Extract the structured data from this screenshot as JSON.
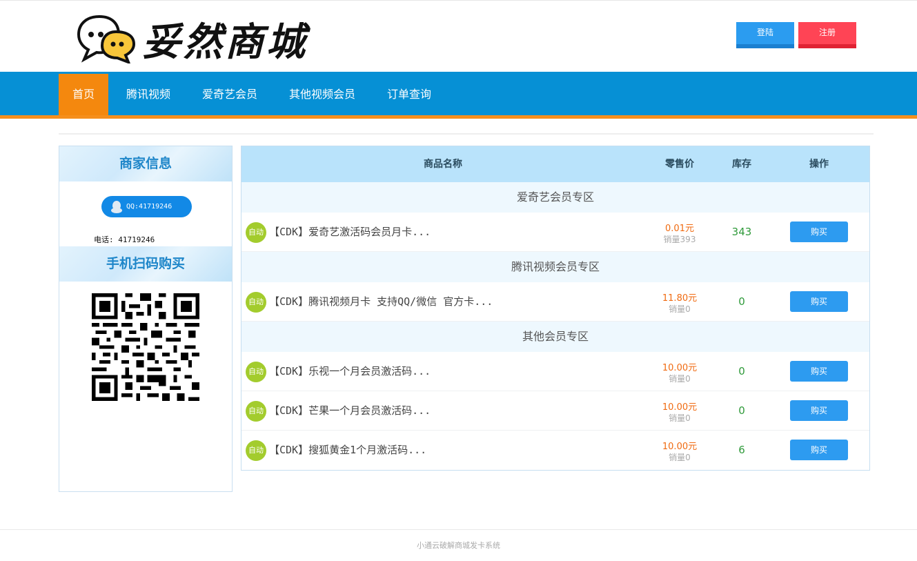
{
  "header": {
    "logo_text": "妥然商城",
    "login_label": "登陆",
    "register_label": "注册"
  },
  "nav": {
    "items": [
      {
        "label": "首页",
        "active": true
      },
      {
        "label": "腾讯视频"
      },
      {
        "label": "爱奇艺会员"
      },
      {
        "label": "其他视频会员"
      },
      {
        "label": "订单查询"
      }
    ]
  },
  "sidebar": {
    "merchant_title": "商家信息",
    "qq_label": "QQ:41719246",
    "phone_label": "电话: 41719246",
    "scan_title": "手机扫码购买"
  },
  "table": {
    "headers": {
      "name": "商品名称",
      "price": "零售价",
      "stock": "库存",
      "action": "操作"
    },
    "sections": [
      {
        "title": "爱奇艺会员专区",
        "rows": [
          {
            "badge": "自动",
            "name": "【CDK】爱奇艺激活码会员月卡...",
            "price": "0.01元",
            "sales": "销量393",
            "stock": "343",
            "buy": "购买"
          }
        ]
      },
      {
        "title": "腾讯视频会员专区",
        "rows": [
          {
            "badge": "自动",
            "name": "【CDK】腾讯视频月卡 支持QQ/微信 官方卡...",
            "price": "11.80元",
            "sales": "销量0",
            "stock": "0",
            "buy": "购买"
          }
        ]
      },
      {
        "title": "其他会员专区",
        "rows": [
          {
            "badge": "自动",
            "name": "【CDK】乐视一个月会员激活码...",
            "price": "10.00元",
            "sales": "销量0",
            "stock": "0",
            "buy": "购买"
          },
          {
            "badge": "自动",
            "name": "【CDK】芒果一个月会员激活码...",
            "price": "10.00元",
            "sales": "销量0",
            "stock": "0",
            "buy": "购买"
          },
          {
            "badge": "自动",
            "name": "【CDK】搜狐黄金1个月激活码...",
            "price": "10.00元",
            "sales": "销量0",
            "stock": "6",
            "buy": "购买"
          }
        ]
      }
    ]
  },
  "footer": {
    "text": "小通云破解商城发卡系统"
  },
  "colors": {
    "nav_bg": "#0690d5",
    "nav_active": "#f4880e",
    "accent_blue": "#2d9bf0",
    "register_red": "#ff4455",
    "price_orange": "#f06a10",
    "stock_green": "#2f9a3a",
    "badge_green": "#a3cc2d"
  }
}
